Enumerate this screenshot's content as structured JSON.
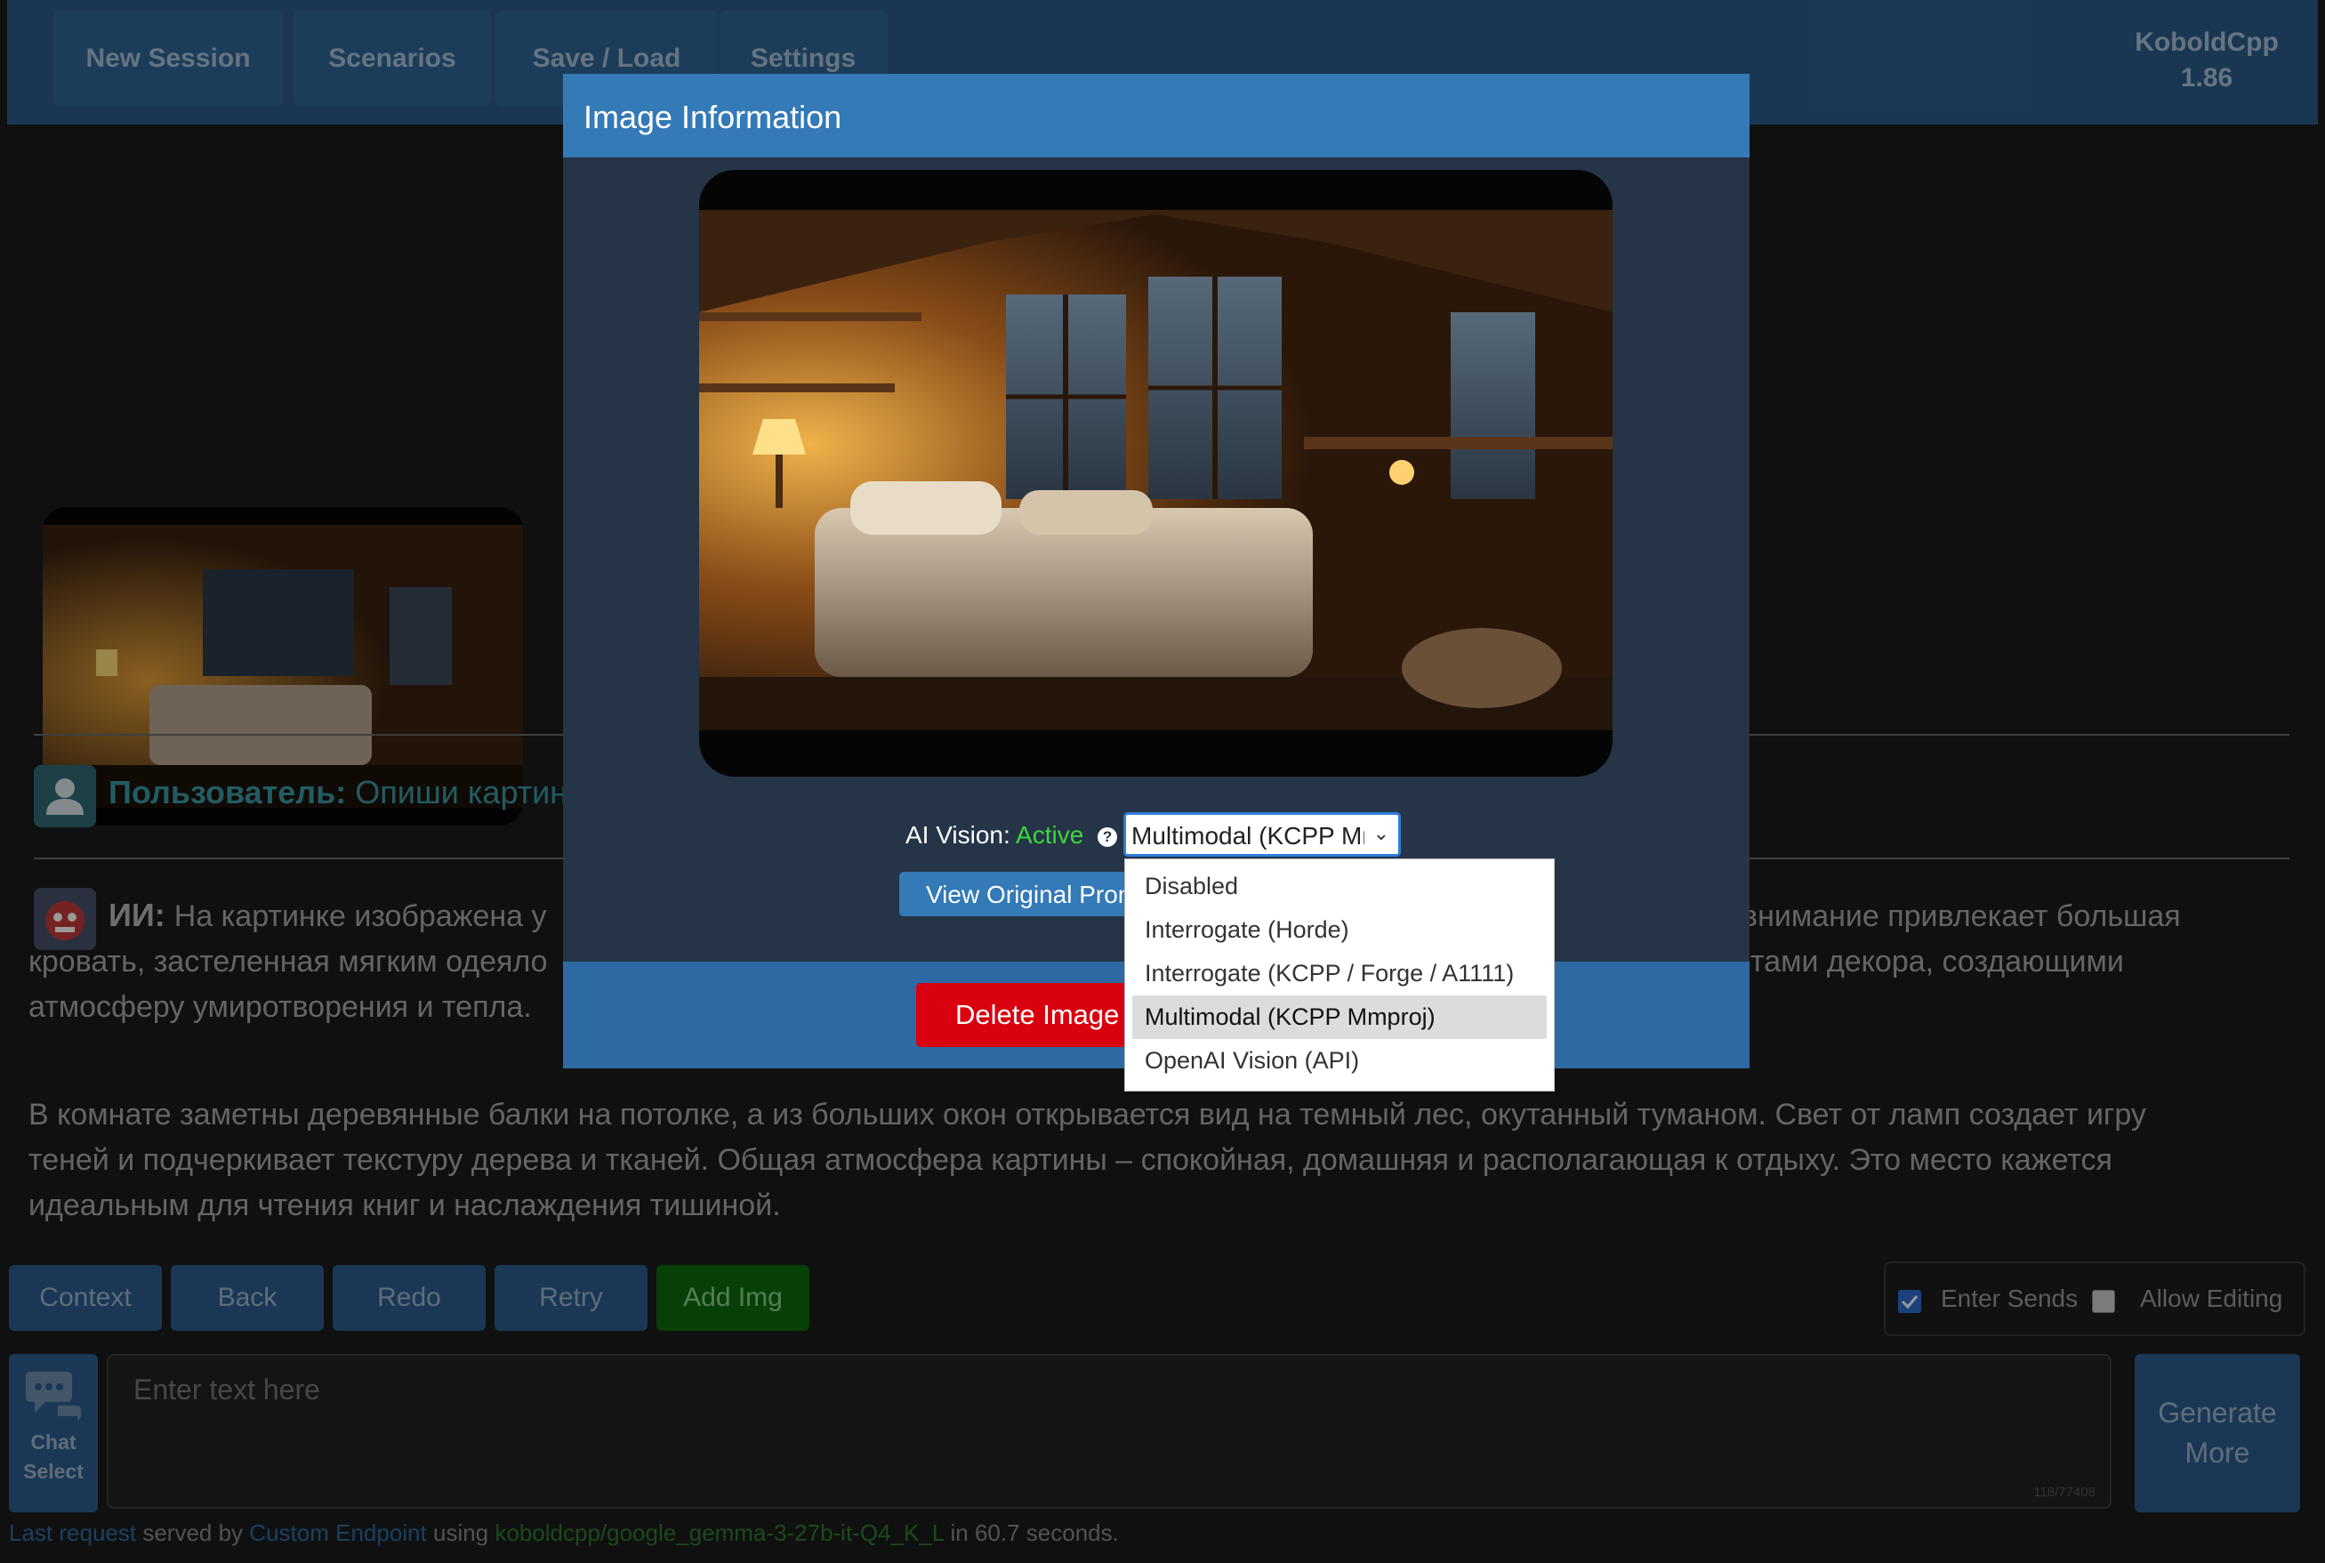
{
  "topbar": {
    "buttons": [
      "New Session",
      "Scenarios",
      "Save / Load",
      "Settings"
    ],
    "brand_name": "KoboldCpp",
    "brand_version": "1.86"
  },
  "chat": {
    "user_label": "Пользователь:",
    "user_text": "Опиши картин",
    "ai_label": "ИИ:",
    "ai_par1_line1_left": "На картинке изображена у",
    "ai_par1_line1_right": "внимание привлекает большая",
    "ai_par1_line2_left": "кровать, застеленная мягким одеяло",
    "ai_par1_line2_right": "тами декора, создающими",
    "ai_par1_line3": "атмосферу умиротворения и тепла.",
    "ai_par2_line1": "В комнате заметны деревянные балки на потолке, а из больших окон открывается вид на темный лес, окутанный туманом. Свет от ламп создает игру",
    "ai_par2_line2": "теней и подчеркивает текстуру дерева и тканей. Общая атмосфера картины – спокойная, домашняя и располагающая к отдыху. Это место кажется",
    "ai_par2_line3": "идеальным для чтения книг и наслаждения тишиной."
  },
  "controls": {
    "buttons": [
      "Context",
      "Back",
      "Redo",
      "Retry",
      "Add Img"
    ],
    "add_img_color": "#0a6b0a",
    "enter_sends_label": "Enter Sends",
    "enter_sends_checked": true,
    "allow_editing_label": "Allow Editing",
    "allow_editing_checked": false,
    "chat_select_line1": "Chat",
    "chat_select_line2": "Select",
    "input_placeholder": "Enter text here",
    "char_counter": "118/77408",
    "generate_line1": "Generate",
    "generate_line2": "More"
  },
  "status": {
    "last_request": "Last request",
    "served_by": "served by",
    "endpoint": "Custom Endpoint",
    "using": "using",
    "model": "koboldcpp/google_gemma-3-27b-it-Q4_K_L",
    "time": "in 60.7 seconds."
  },
  "modal": {
    "title": "Image Information",
    "vision_label": "AI Vision:",
    "vision_status": "Active",
    "help_icon": "?",
    "selected_option": "Multimodal (KCPP Mmproj)",
    "view_prompt_button": "View Original Prompt",
    "delete_button": "Delete Image",
    "options": [
      "Disabled",
      "Interrogate (Horde)",
      "Interrogate (KCPP / Forge / A1111)",
      "Multimodal (KCPP Mmproj)",
      "OpenAI Vision (API)"
    ],
    "selected_index": 3
  }
}
